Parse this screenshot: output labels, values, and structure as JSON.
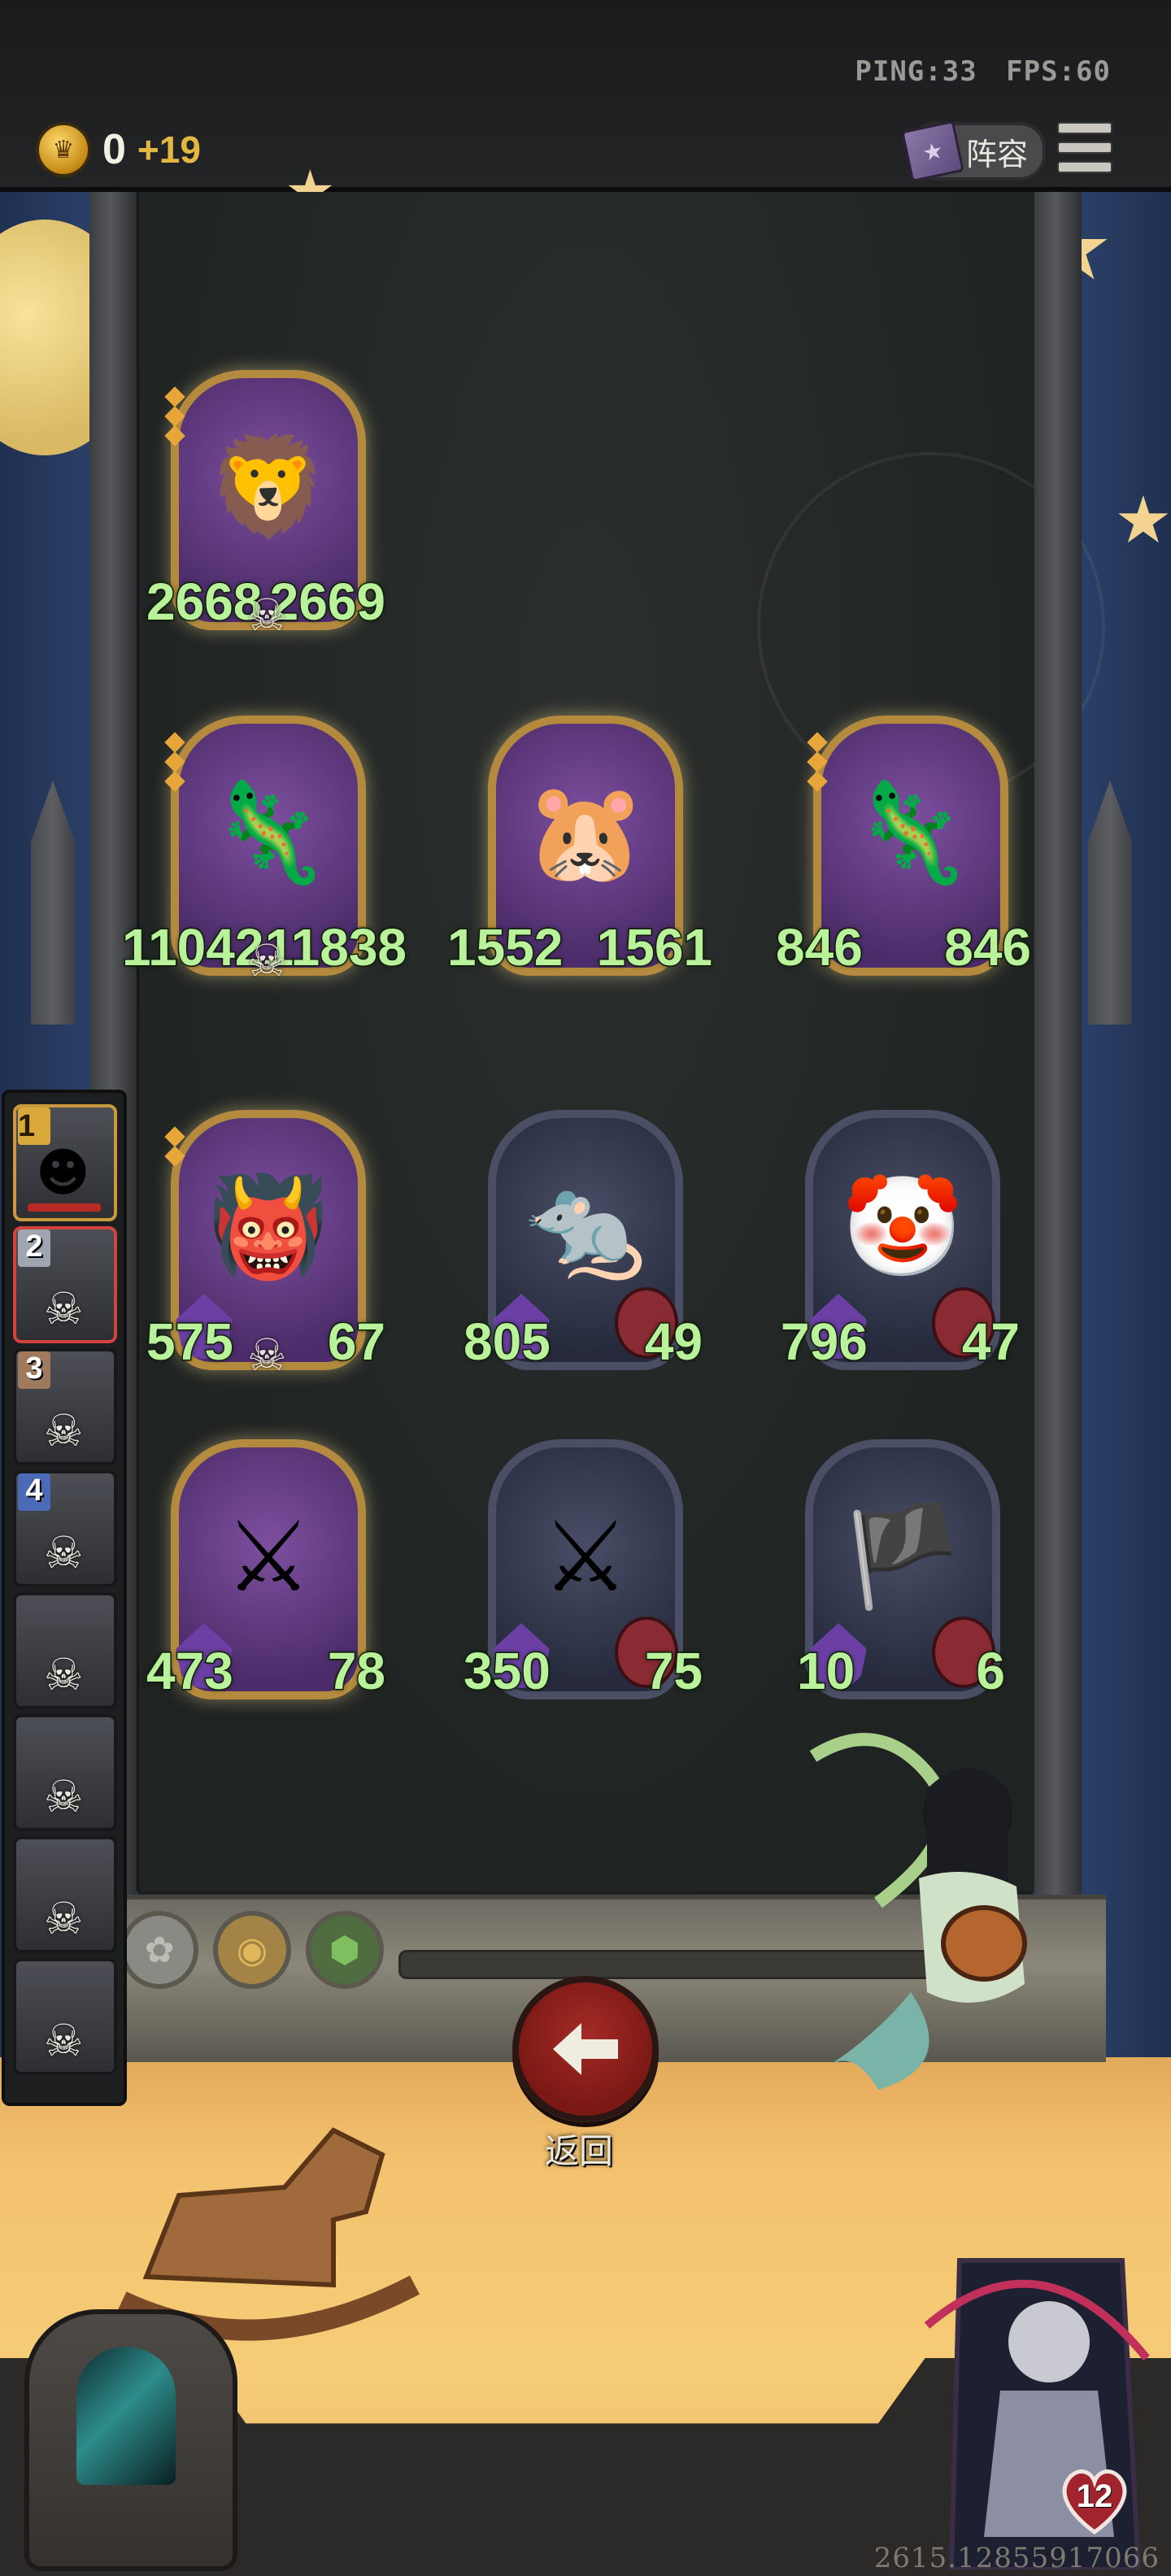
{
  "topbar": {
    "ping": "PING:33",
    "fps": "FPS:60",
    "gold": "0",
    "gold_income": "+19",
    "lineup_label": "阵容"
  },
  "board": {
    "cards": [
      {
        "id": "gold-lion",
        "atk": "2668",
        "hp": "2669",
        "golden": true,
        "skull": true,
        "icon": "lion-beast-icon"
      },
      {
        "id": "gecko-1",
        "atk": "11042",
        "hp": "11838",
        "golden": true,
        "skull": true,
        "icon": "gecko-icon"
      },
      {
        "id": "hamster",
        "atk": "1552",
        "hp": "1561",
        "golden": true,
        "skull": false,
        "icon": "hamster-icon"
      },
      {
        "id": "gecko-2",
        "atk": "846",
        "hp": "846",
        "golden": true,
        "skull": false,
        "icon": "gecko-icon"
      },
      {
        "id": "ogre",
        "atk": "575",
        "hp": "67",
        "golden": true,
        "skull": true,
        "icon": "ogre-icon"
      },
      {
        "id": "rat",
        "atk": "805",
        "hp": "49",
        "golden": false,
        "skull": false,
        "icon": "rat-icon"
      },
      {
        "id": "clown",
        "atk": "796",
        "hp": "47",
        "golden": false,
        "skull": false,
        "icon": "clown-icon"
      },
      {
        "id": "knight-1",
        "atk": "473",
        "hp": "78",
        "golden": true,
        "skull": false,
        "icon": "knight-icon"
      },
      {
        "id": "knight-2",
        "atk": "350",
        "hp": "75",
        "golden": false,
        "skull": false,
        "icon": "knight-icon"
      },
      {
        "id": "pirate",
        "atk": "10",
        "hp": "6",
        "golden": false,
        "skull": false,
        "icon": "pirate-icon"
      }
    ]
  },
  "roster": [
    {
      "num": "1",
      "style": "gold",
      "skull": false
    },
    {
      "num": "2",
      "style": "silver",
      "skull": true,
      "selected": true
    },
    {
      "num": "3",
      "style": "bronze",
      "skull": true
    },
    {
      "num": "4",
      "style": "blue",
      "skull": true
    },
    {
      "num": "",
      "style": "",
      "skull": true
    },
    {
      "num": "",
      "style": "",
      "skull": true
    },
    {
      "num": "",
      "style": "",
      "skull": true
    },
    {
      "num": "",
      "style": "",
      "skull": true
    }
  ],
  "back_label": "返回",
  "hero_level": "12",
  "debug_number": "2615.12855917066",
  "colors": {
    "stat_text": "#b9f29a",
    "gold_income": "#e3b842",
    "back_button": "#a42b26",
    "floor": "#f3c26e"
  }
}
